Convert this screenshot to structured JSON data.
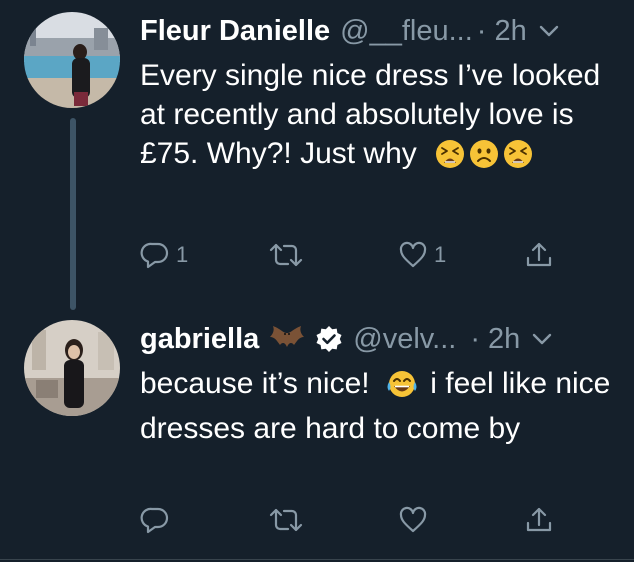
{
  "tweets": [
    {
      "name": "Fleur Danielle",
      "handle": "@__fleu...",
      "time": "· 2h",
      "text": "Every single nice dress I’ve looked at recently and absolutely love is £75. Why?! Just why",
      "emojis": [
        "tired-face",
        "frowning-face",
        "tired-face"
      ],
      "reply_count": "1",
      "like_count": "1"
    },
    {
      "name": "gabriella",
      "handle": "@velv...",
      "time": "· 2h",
      "verified": true,
      "name_emoji": "bat",
      "text_part1": "because it’s nice!",
      "text_part2": "i feel like nice dresses are hard to come by",
      "inline_emoji": "tears-of-joy-face"
    }
  ],
  "colors": {
    "background": "#15202b",
    "secondary_text": "#8899a6",
    "thread_line": "#3d5466",
    "emoji_yellow": "#f7c337"
  }
}
